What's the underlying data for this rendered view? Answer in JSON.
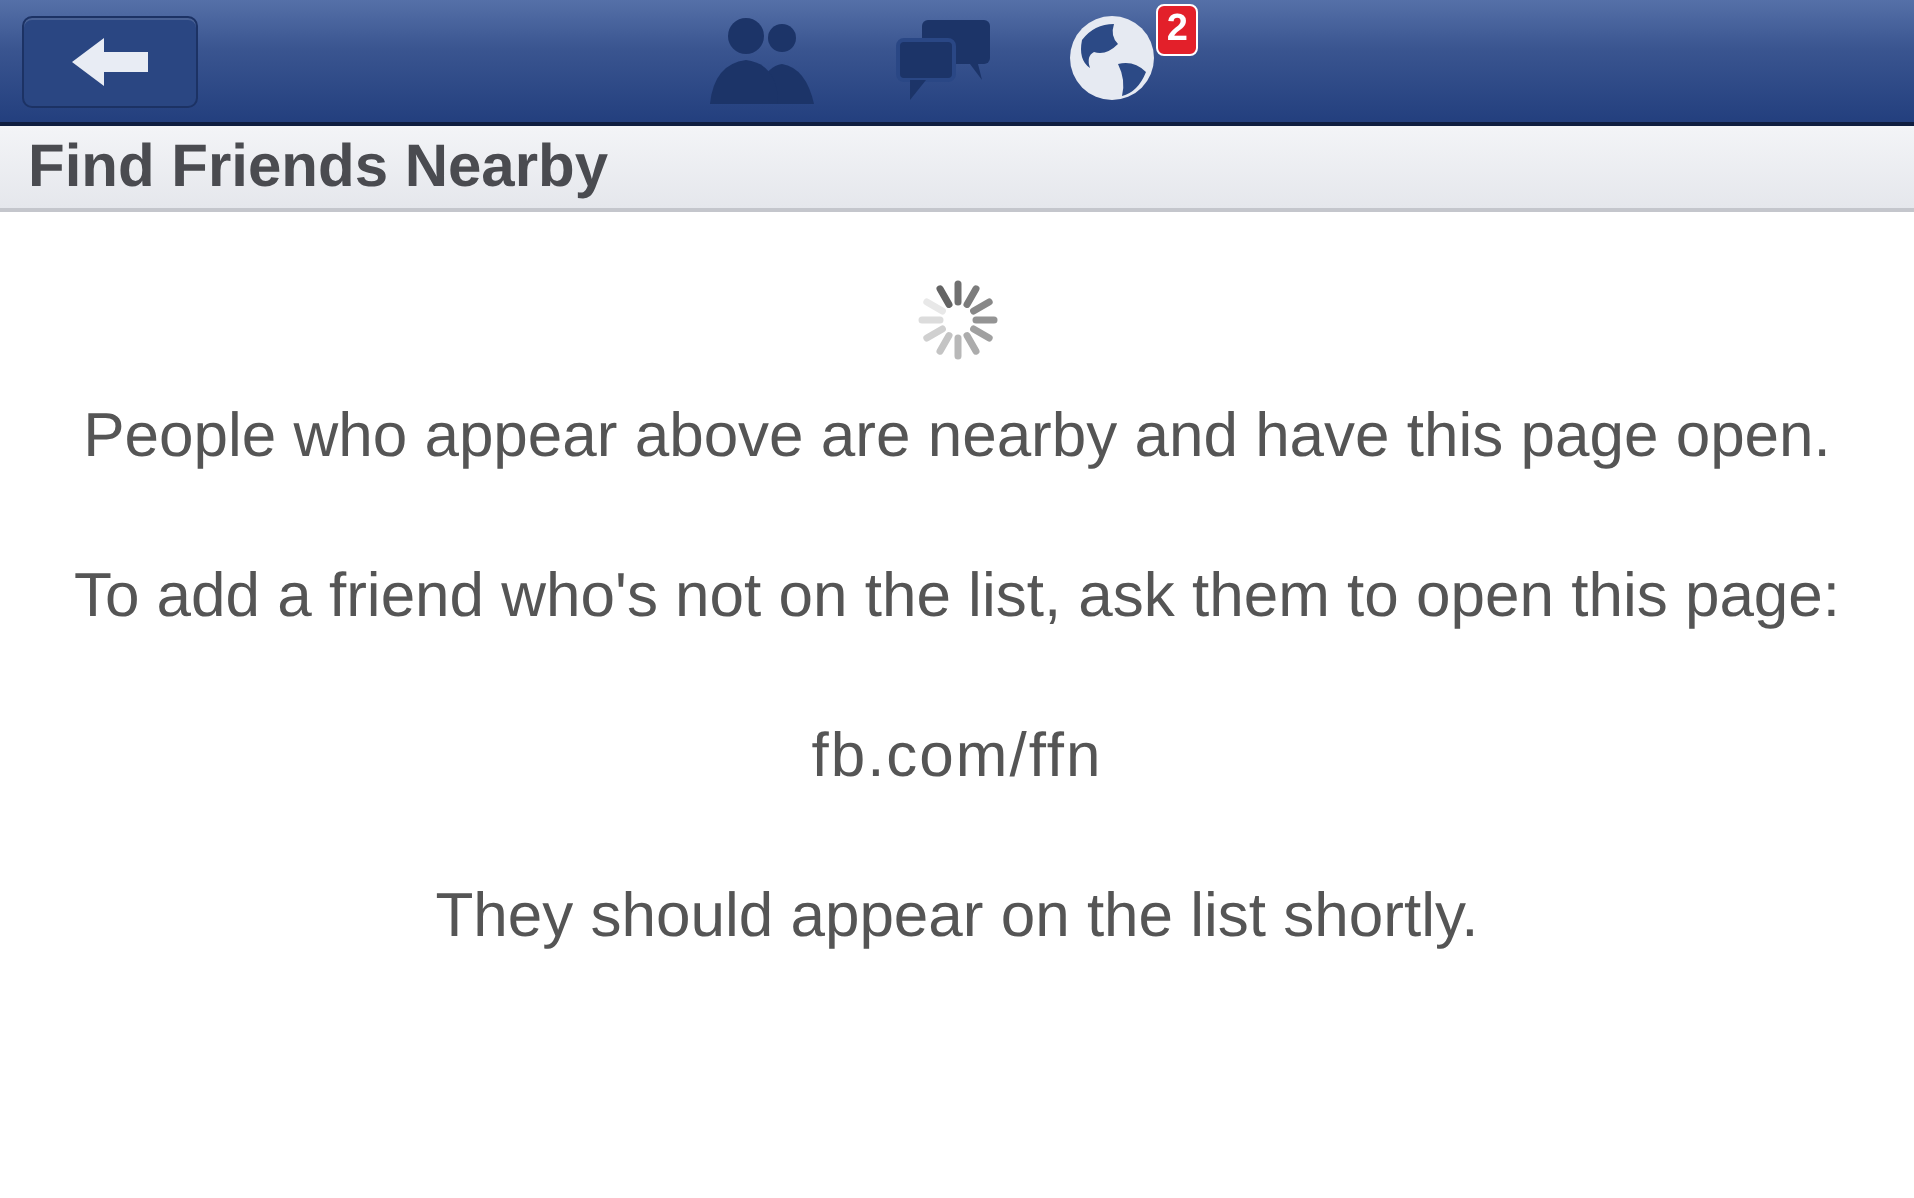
{
  "nav_bar": {
    "icons": [
      {
        "kind": "friends"
      },
      {
        "kind": "messages"
      },
      {
        "kind": "notifications",
        "badge": "2"
      }
    ]
  },
  "section_title": "Find Friends Nearby",
  "loading": true,
  "body": [
    {
      "kind": "paragraph",
      "text": "People who appear above are nearby and have this page open."
    },
    {
      "kind": "paragraph",
      "text": "To add a friend who's not on the list, ask them to open this page:"
    },
    {
      "kind": "link",
      "text": "fb.com/ffn"
    },
    {
      "kind": "paragraph",
      "text": "They should appear on the list shortly."
    }
  ]
}
